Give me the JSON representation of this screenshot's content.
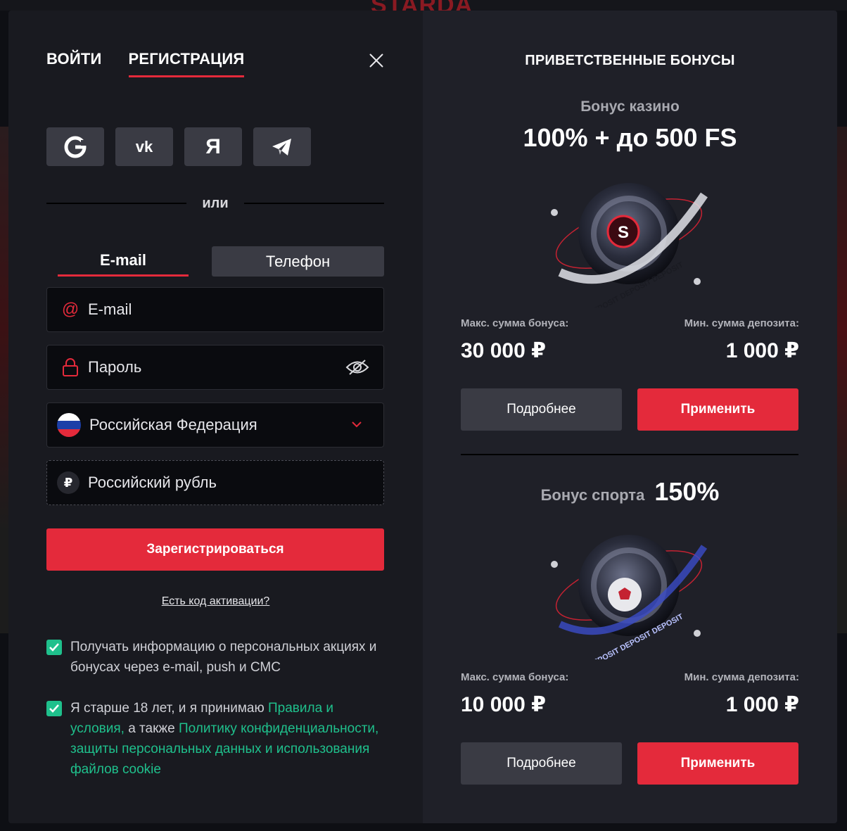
{
  "background": {
    "logo_text": "STARDA"
  },
  "auth": {
    "tab_login": "ВОЙТИ",
    "tab_register": "РЕГИСТРАЦИЯ",
    "social": [
      {
        "name": "google",
        "glyph": "G"
      },
      {
        "name": "vk",
        "glyph": "vk"
      },
      {
        "name": "yandex",
        "glyph": "Я"
      },
      {
        "name": "telegram",
        "glyph": "telegram-icon"
      }
    ],
    "divider_text": "или",
    "method_email": "E-mail",
    "method_phone": "Телефон",
    "email_placeholder": "E-mail",
    "password_placeholder": "Пароль",
    "country": "Российская Федерация",
    "currency": "Российский рубль",
    "currency_symbol": "₽",
    "register_button": "Зарегистрироваться",
    "activation_link": "Есть код активации?",
    "consent_marketing": "Получать информацию о персональных акциях и бонусах через e-mail, push и СМС",
    "consent_age_prefix": "Я старше 18 лет, и я принимаю ",
    "consent_rules_link": "Правила и условия,",
    "consent_middle": " а также ",
    "consent_privacy_link": "Политику конфиденциальности, защиты персональных данных и использования файлов cookie",
    "checkbox_marketing_checked": true,
    "checkbox_age_checked": true
  },
  "bonuses": {
    "title": "ПРИВЕТСТВЕННЫЕ БОНУСЫ",
    "casino": {
      "label": "Бонус казино",
      "headline": "100% + до 500 FS",
      "max_label": "Макс. сумма бонуса:",
      "max_value": "30 000 ₽",
      "min_label": "Мин. сумма депозита:",
      "min_value": "1 000 ₽",
      "more_button": "Подробнее",
      "apply_button": "Применить"
    },
    "sport": {
      "label": "Бонус спорта",
      "headline": "150%",
      "max_label": "Макс. сумма бонуса:",
      "max_value": "10 000 ₽",
      "min_label": "Мин. сумма депозита:",
      "min_value": "1 000 ₽",
      "more_button": "Подробнее",
      "apply_button": "Применить"
    }
  },
  "colors": {
    "accent": "#e42a3b",
    "success": "#1fc08c",
    "panel_left": "#191a20",
    "panel_right": "#1f2028",
    "button_secondary": "#3a3b44"
  }
}
